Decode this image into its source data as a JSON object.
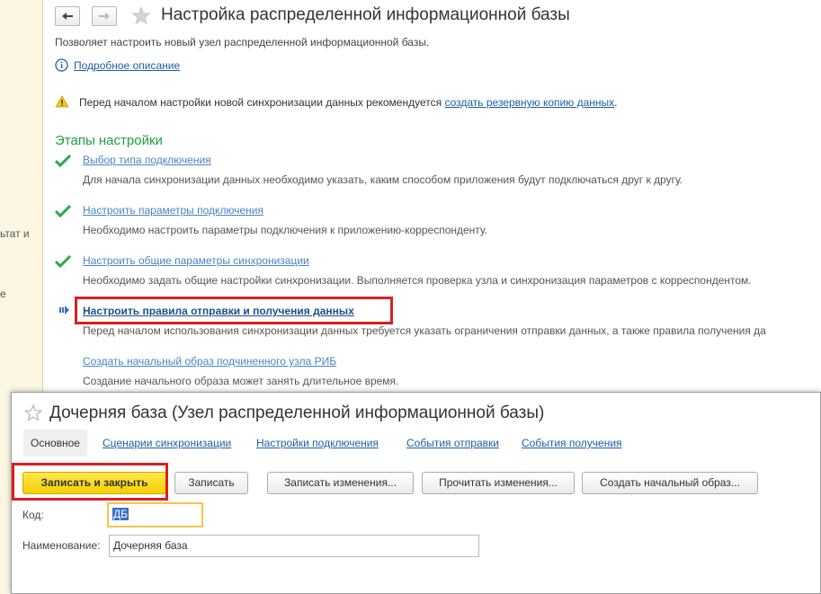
{
  "left_strip": {
    "fragment_1": "ьтат и",
    "fragment_2": "е"
  },
  "back_window": {
    "title": "Настройка распределенной информационной базы",
    "subtitle": "Позволяет настроить новый узел распределенной информационной базы.",
    "details_link": "Подробное описание",
    "warning_text": "Перед началом настройки новой синхронизации данных рекомендуется",
    "warning_link": "создать резервную копию данных",
    "warning_end": ".",
    "steps_heading": "Этапы настройки",
    "steps": [
      {
        "label": "Выбор типа подключения",
        "description": "Для начала синхронизации данных необходимо указать, каким способом приложения будут подключаться друг к другу.",
        "status": "done"
      },
      {
        "label": "Настроить параметры подключения",
        "description": "Необходимо настроить параметры подключения к приложению-корреспонденту.",
        "status": "done"
      },
      {
        "label": "Настроить общие параметры синхронизации",
        "description": "Необходимо задать общие настройки синхронизации. Выполняется проверка узла и синхронизация параметров с корреспондентом.",
        "status": "done"
      },
      {
        "label": "Настроить правила отправки и получения данных",
        "description": "Перед началом использования синхронизации данных требуется указать ограничения отправки данных, а также правила получения да",
        "status": "current"
      },
      {
        "label": "Создать начальный образ подчиненного узла РИБ",
        "description": "Создание начального образа может занять длительное время.",
        "status": "pending"
      }
    ]
  },
  "front_window": {
    "title": "Дочерняя база (Узел распределенной информационной базы)",
    "tabs": [
      "Основное",
      "Сценарии синхронизации",
      "Настройки подключения",
      "События отправки",
      "События получения"
    ],
    "buttons": {
      "save_close": "Записать и закрыть",
      "save": "Записать",
      "save_changes": "Записать изменения...",
      "read_changes": "Прочитать изменения...",
      "create_image": "Создать начальный образ..."
    },
    "fields": {
      "code_label": "Код:",
      "code_value": "ДБ",
      "name_label": "Наименование:",
      "name_value": "Дочерняя база"
    }
  },
  "colors": {
    "link": "#1e5fa0",
    "green_heading": "#1f9e3f",
    "highlight_red": "#d8201f",
    "primary_button": "#f4cf00"
  }
}
